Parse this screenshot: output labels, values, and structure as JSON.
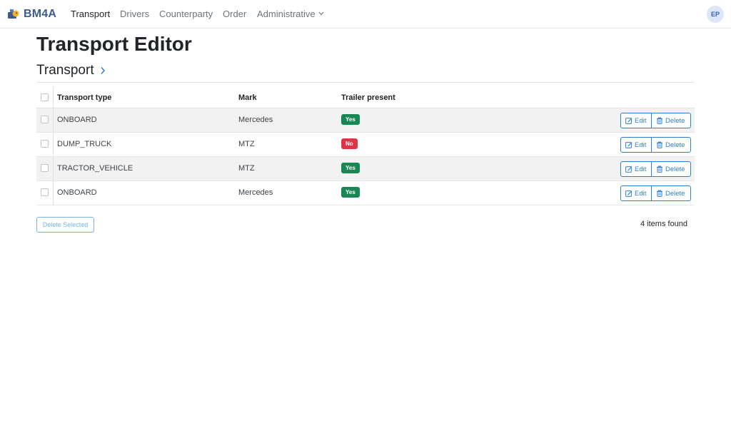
{
  "brand": {
    "name": "BM4A",
    "logo_icon": "bm4a-logo-icon"
  },
  "nav": {
    "items": [
      {
        "label": "Transport",
        "active": true
      },
      {
        "label": "Drivers"
      },
      {
        "label": "Counterparty"
      },
      {
        "label": "Order"
      },
      {
        "label": "Administrative",
        "has_dropdown": true
      }
    ]
  },
  "user": {
    "initials": "EP"
  },
  "page": {
    "title": "Transport Editor",
    "section": "Transport"
  },
  "table": {
    "columns": [
      "Transport type",
      "Mark",
      "Trailer present"
    ],
    "rows": [
      {
        "type": "ONBOARD",
        "mark": "Mercedes",
        "trailer": "Yes",
        "trailer_status": "success"
      },
      {
        "type": "DUMP_TRUCK",
        "mark": "MTZ",
        "trailer": "No",
        "trailer_status": "danger"
      },
      {
        "type": "TRACTOR_VEHICLE",
        "mark": "MTZ",
        "trailer": "Yes",
        "trailer_status": "success"
      },
      {
        "type": "ONBOARD",
        "mark": "Mercedes",
        "trailer": "Yes",
        "trailer_status": "success"
      }
    ],
    "actions": {
      "edit_label": "Edit",
      "delete_label": "Delete"
    }
  },
  "footer": {
    "delete_selected_label": "Delete Selected",
    "items_found": "4 items found"
  },
  "colors": {
    "brand": "#3e5a8a",
    "primary": "#2f7fd1",
    "success": "#198754",
    "danger": "#dc3545",
    "stripe": "#f2f2f2"
  }
}
